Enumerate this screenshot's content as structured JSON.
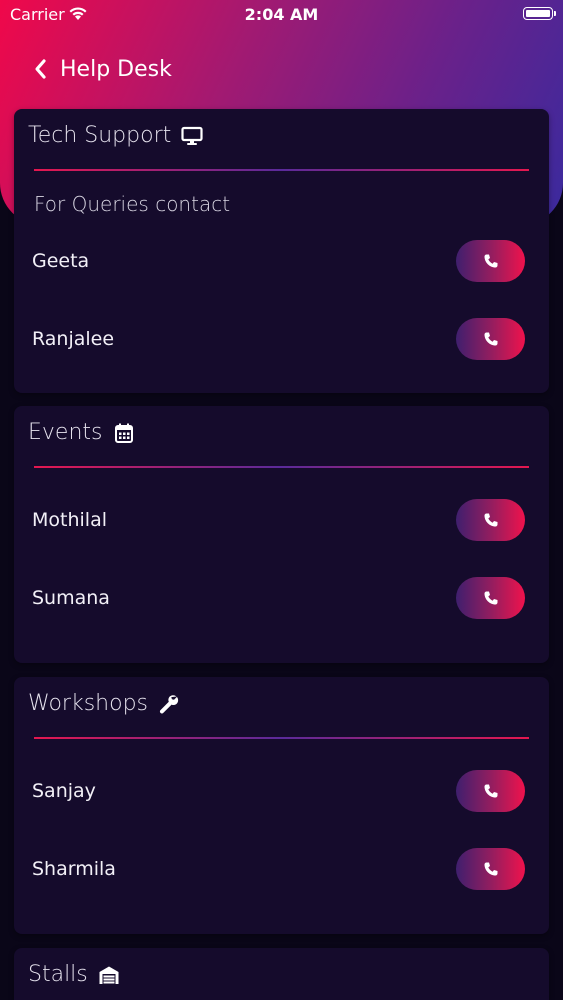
{
  "status_bar": {
    "carrier": "Carrier",
    "time": "2:04 AM"
  },
  "nav": {
    "title": "Help Desk"
  },
  "sections": [
    {
      "title": "Tech Support",
      "icon": "monitor-icon",
      "subtitle": "For Queries contact",
      "contacts": [
        {
          "name": "Geeta"
        },
        {
          "name": "Ranjalee"
        }
      ]
    },
    {
      "title": "Events",
      "icon": "calendar-icon",
      "contacts": [
        {
          "name": "Mothilal"
        },
        {
          "name": "Sumana"
        }
      ]
    },
    {
      "title": "Workshops",
      "icon": "wrench-icon",
      "contacts": [
        {
          "name": "Sanjay"
        },
        {
          "name": "Sharmila"
        }
      ]
    },
    {
      "title": "Stalls",
      "icon": "warehouse-icon",
      "contacts": []
    }
  ],
  "colors": {
    "accent_start": "#f0084a",
    "accent_end": "#3a2a9e",
    "card_bg": "#150b2c",
    "page_bg": "#0a0618"
  }
}
